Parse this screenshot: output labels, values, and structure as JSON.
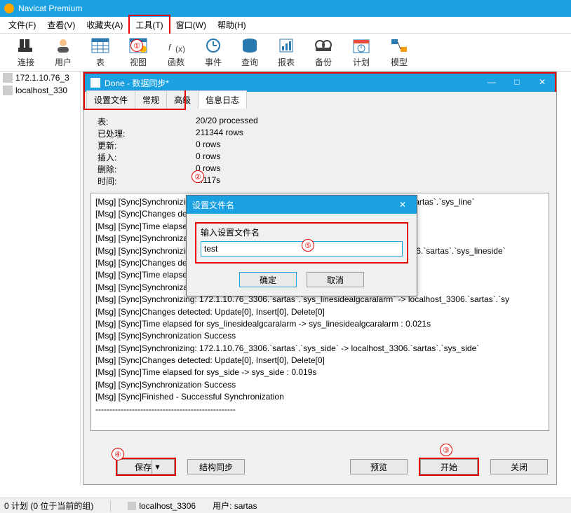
{
  "app_title": "Navicat Premium",
  "menu": {
    "file": "文件(F)",
    "view": "查看(V)",
    "favorites": "收藏夹(A)",
    "tools": "工具(T)",
    "window": "窗口(W)",
    "help": "帮助(H)"
  },
  "toolbar": {
    "connection": "连接",
    "user": "用户",
    "table": "表",
    "view": "视图",
    "func": "函数",
    "event": "事件",
    "query": "查询",
    "report": "报表",
    "backup": "备份",
    "schedule": "计划",
    "model": "模型"
  },
  "sidebar": {
    "conn1": "172.1.10.76_3",
    "conn2": "localhost_330"
  },
  "done_dialog": {
    "title": "Done - 数据同步*",
    "tabs": {
      "profile": "设置文件",
      "general": "常规",
      "advanced": "高级",
      "log": "信息日志"
    },
    "stats": {
      "table_k": "表:",
      "table_v": "20/20 processed",
      "processed_k": "已处理:",
      "processed_v": "211344 rows",
      "updated_k": "更新:",
      "updated_v": "0 rows",
      "inserted_k": "插入:",
      "inserted_v": "0 rows",
      "deleted_k": "删除:",
      "deleted_v": "0 rows",
      "time_k": "时间:",
      "time_v": "2.117s"
    },
    "log_lines": [
      "[Msg] [Sync]Synchronizing: 172.1.10.76_3306.`sartas`.`sys_line` -> localhost_3306.`sartas`.`sys_line`",
      "[Msg] [Sync]Changes detected: Update[0], Insert[0], Delete[0]",
      "[Msg] [Sync]Time elapsed for sys_line -> sys_line : 0.020s",
      "[Msg] [Sync]Synchronization Success",
      "[Msg] [Sync]Synchronizing: 172.1.10.76_3306.`sartas`.`sys_lineside` -> localhost_3306.`sartas`.`sys_lineside`",
      "[Msg] [Sync]Changes detected: Update[0], Insert[0], Delete[0]",
      "[Msg] [Sync]Time elapsed for sys_lineside -> sys_lineside : 0.019s",
      "[Msg] [Sync]Synchronization Success",
      "[Msg] [Sync]Synchronizing: 172.1.10.76_3306.`sartas`.`sys_linesidealgcaralarm` -> localhost_3306.`sartas`.`sy",
      "[Msg] [Sync]Changes detected: Update[0], Insert[0], Delete[0]",
      "[Msg] [Sync]Time elapsed for sys_linesidealgcaralarm -> sys_linesidealgcaralarm : 0.021s",
      "[Msg] [Sync]Synchronization Success",
      "[Msg] [Sync]Synchronizing: 172.1.10.76_3306.`sartas`.`sys_side` -> localhost_3306.`sartas`.`sys_side`",
      "[Msg] [Sync]Changes detected: Update[0], Insert[0], Delete[0]",
      "[Msg] [Sync]Time elapsed for sys_side -> sys_side : 0.019s",
      "[Msg] [Sync]Synchronization Success",
      "[Msg] [Sync]Finished - Successful Synchronization",
      "--------------------------------------------------"
    ],
    "footer": {
      "save": "保存",
      "struct_sync": "结构同步",
      "preview": "预览",
      "start": "开始",
      "close": "关闭"
    }
  },
  "save_dialog": {
    "title": "设置文件名",
    "label": "输入设置文件名",
    "value": "test",
    "ok": "确定",
    "cancel": "取消"
  },
  "statusbar": {
    "left": "0 计划 (0 位于当前的组)",
    "conn": "localhost_3306",
    "user_label": "用户:",
    "user_value": "sartas"
  },
  "annotations": {
    "a1": "①",
    "a2": "②",
    "a3": "③",
    "a4": "④",
    "a5": "⑤"
  }
}
